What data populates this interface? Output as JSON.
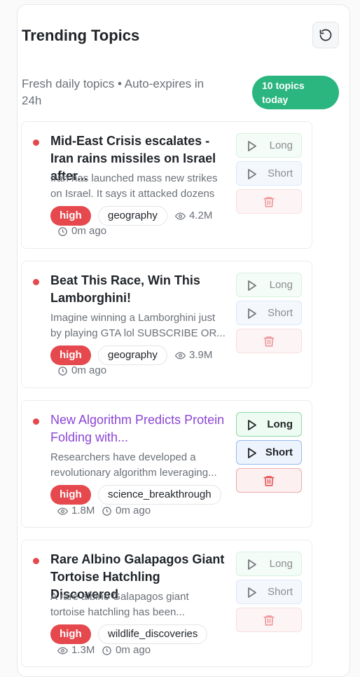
{
  "header": {
    "title": "Trending Topics",
    "refresh_icon": "refresh-icon"
  },
  "subtitle": "Fresh daily topics • Auto-expires in 24h",
  "count_badge": "10 topics today",
  "actions": {
    "long_label": "Long",
    "short_label": "Short"
  },
  "topics": [
    {
      "title": "Mid-East Crisis escalates - Iran rains missiles on Israel after...",
      "description": "Iran has launched mass new strikes on Israel. It says it attacked dozens ...",
      "priority": "high",
      "category": "geography",
      "views": "4.2M",
      "age": "0m ago"
    },
    {
      "title": "Beat This Race, Win This Lamborghini!",
      "description": "Imagine winning a Lamborghini just by playing GTA lol SUBSCRIBE OR...",
      "priority": "high",
      "category": "geography",
      "views": "3.9M",
      "age": "0m ago"
    },
    {
      "title": "New Algorithm Predicts Protein Folding with...",
      "description": "Researchers have developed a revolutionary algorithm leveraging...",
      "priority": "high",
      "category": "science_breakthrough",
      "views": "1.8M",
      "age": "0m ago"
    },
    {
      "title": "Rare Albino Galapagos Giant Tortoise Hatchling Discovered",
      "description": "A rare albino Galapagos giant tortoise hatchling has been...",
      "priority": "high",
      "category": "wildlife_discoveries",
      "views": "1.3M",
      "age": "0m ago"
    }
  ],
  "colors": {
    "accent_green": "#2bb57f",
    "priority_high": "#e5484d",
    "active_title": "#8b45d6"
  }
}
